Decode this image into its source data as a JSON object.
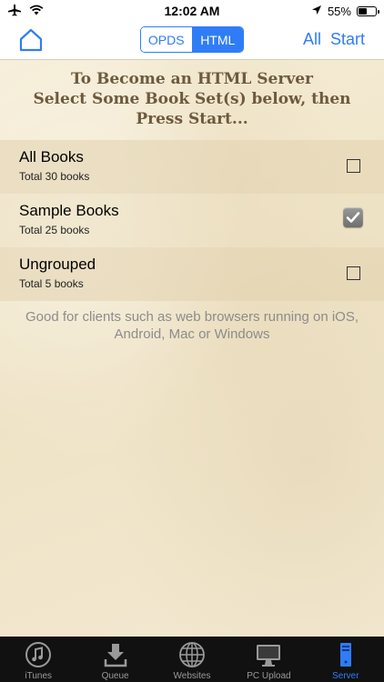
{
  "status_bar": {
    "time": "12:02 AM",
    "battery": "55%",
    "battery_level": 0.55,
    "icons": [
      "airplane-icon",
      "wifi-icon",
      "location-icon",
      "battery-icon"
    ]
  },
  "nav": {
    "home_icon": "home-icon",
    "segments": [
      "OPDS",
      "HTML"
    ],
    "active_segment": "HTML",
    "all_label": "All",
    "start_label": "Start"
  },
  "heading": {
    "line1": "To Become an HTML Server",
    "line2": "Select Some Book Set(s) below, then",
    "line3": "Press Start..."
  },
  "book_sets": [
    {
      "title": "All Books",
      "subtitle": "Total 30 books",
      "checked": false
    },
    {
      "title": "Sample Books",
      "subtitle": "Total 25 books",
      "checked": true
    },
    {
      "title": "Ungrouped",
      "subtitle": "Total 5 books",
      "checked": false
    }
  ],
  "footnote": "Good for clients such as web browsers running on iOS, Android, Mac or Windows",
  "tabs": [
    {
      "label": "iTunes",
      "icon": "music-note-icon",
      "active": false
    },
    {
      "label": "Queue",
      "icon": "download-tray-icon",
      "active": false
    },
    {
      "label": "Websites",
      "icon": "globe-icon",
      "active": false
    },
    {
      "label": "PC Upload",
      "icon": "monitor-icon",
      "active": false
    },
    {
      "label": "Server",
      "icon": "server-tower-icon",
      "active": true
    }
  ],
  "colors": {
    "accent": "#2f7df6",
    "tab_bar": "#111111",
    "heading": "#6d5a3e",
    "parchment": "#f4ead2"
  }
}
